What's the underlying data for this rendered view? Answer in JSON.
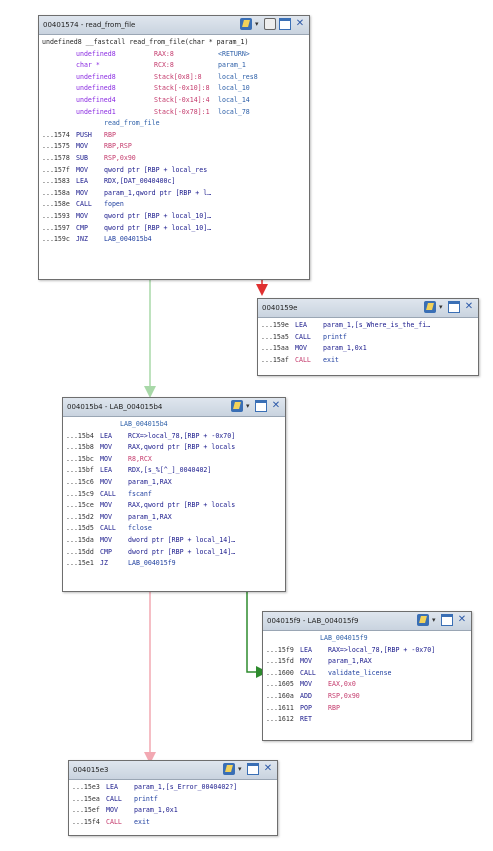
{
  "colors": {
    "edge_true": "#3aa63a",
    "edge_false": "#e03030",
    "edge_uncond": "#a8d8a8",
    "edge_pink": "#f2a8b2"
  },
  "blocks": {
    "read_from_file": {
      "title": "00401574 - read_from_file",
      "signature": "undefined8 __fastcall read_from_file(char * param_1)",
      "vars": [
        {
          "type": "undefined8",
          "loc": "RAX:8",
          "name": "<RETURN>"
        },
        {
          "type": "char *",
          "loc": "RCX:8",
          "name": "param_1"
        },
        {
          "type": "undefined8",
          "loc": "Stack[0x8]:8",
          "name": "local_res8"
        },
        {
          "type": "undefined8",
          "loc": "Stack[-0x10]:8",
          "name": "local_10"
        },
        {
          "type": "undefined4",
          "loc": "Stack[-0x14]:4",
          "name": "local_14"
        },
        {
          "type": "undefined1",
          "loc": "Stack[-0x78]:1",
          "name": "local_78"
        }
      ],
      "label": "read_from_file",
      "lines": [
        {
          "addr": "...1574",
          "mn": "PUSH",
          "ops": "RBP"
        },
        {
          "addr": "...1575",
          "mn": "MOV",
          "ops": "RBP,RSP"
        },
        {
          "addr": "...1578",
          "mn": "SUB",
          "ops": "RSP,0x90"
        },
        {
          "addr": "...157f",
          "mn": "MOV",
          "ops": "qword ptr [RBP + local_res"
        },
        {
          "addr": "...1583",
          "mn": "LEA",
          "ops": "RDX,[DAT_0040400c]"
        },
        {
          "addr": "...158a",
          "mn": "MOV",
          "ops": "param_1,qword ptr [RBP + l…"
        },
        {
          "addr": "...158e",
          "mn": "CALL",
          "ops": "fopen"
        },
        {
          "addr": "...1593",
          "mn": "MOV",
          "ops": "qword ptr [RBP + local_10]…"
        },
        {
          "addr": "...1597",
          "mn": "CMP",
          "ops": "qword ptr [RBP + local_10]…"
        },
        {
          "addr": "...159c",
          "mn": "JNZ",
          "ops": "LAB_004015b4"
        }
      ]
    },
    "blk_159e": {
      "title": "0040159e",
      "lines": [
        {
          "addr": "...159e",
          "mn": "LEA",
          "ops": "param_1,[s_Where_is_the_fi…"
        },
        {
          "addr": "...15a5",
          "mn": "CALL",
          "ops": "printf"
        },
        {
          "addr": "...15aa",
          "mn": "MOV",
          "ops": "param_1,0x1"
        },
        {
          "addr": "...15af",
          "mn": "CALL",
          "ops": "exit"
        }
      ]
    },
    "blk_15b4": {
      "title": "004015b4 - LAB_004015b4",
      "label": "LAB_004015b4",
      "lines": [
        {
          "addr": "...15b4",
          "mn": "LEA",
          "ops": "RCX=>local_78,[RBP + -0x70]"
        },
        {
          "addr": "...15b8",
          "mn": "MOV",
          "ops": "RAX,qword ptr [RBP + locals"
        },
        {
          "addr": "...15bc",
          "mn": "MOV",
          "ops": "R8,RCX"
        },
        {
          "addr": "...15bf",
          "mn": "LEA",
          "ops": "RDX,[s_%[^_]_0040402]"
        },
        {
          "addr": "...15c6",
          "mn": "MOV",
          "ops": "param_1,RAX"
        },
        {
          "addr": "...15c9",
          "mn": "CALL",
          "ops": "fscanf"
        },
        {
          "addr": "...15ce",
          "mn": "MOV",
          "ops": "RAX,qword ptr [RBP + locals"
        },
        {
          "addr": "...15d2",
          "mn": "MOV",
          "ops": "param_1,RAX"
        },
        {
          "addr": "...15d5",
          "mn": "CALL",
          "ops": "fclose"
        },
        {
          "addr": "...15da",
          "mn": "MOV",
          "ops": "dword ptr [RBP + local_14]…"
        },
        {
          "addr": "...15dd",
          "mn": "CMP",
          "ops": "dword ptr [RBP + local_14]…"
        },
        {
          "addr": "...15e1",
          "mn": "JZ",
          "ops": "LAB_004015f9"
        }
      ]
    },
    "blk_15f9": {
      "title": "004015f9 - LAB_004015f9",
      "label": "LAB_004015f9",
      "lines": [
        {
          "addr": "...15f9",
          "mn": "LEA",
          "ops": "RAX=>local_78,[RBP + -0x70]"
        },
        {
          "addr": "...15fd",
          "mn": "MOV",
          "ops": "param_1,RAX"
        },
        {
          "addr": "...1600",
          "mn": "CALL",
          "ops": "validate_license"
        },
        {
          "addr": "...1605",
          "mn": "MOV",
          "ops": "EAX,0x0"
        },
        {
          "addr": "...160a",
          "mn": "ADD",
          "ops": "RSP,0x90"
        },
        {
          "addr": "...1611",
          "mn": "POP",
          "ops": "RBP"
        },
        {
          "addr": "...1612",
          "mn": "RET",
          "ops": ""
        }
      ]
    },
    "blk_15e3": {
      "title": "004015e3",
      "lines": [
        {
          "addr": "...15e3",
          "mn": "LEA",
          "ops": "param_1,[s_Error_0040402?]"
        },
        {
          "addr": "...15ea",
          "mn": "CALL",
          "ops": "printf"
        },
        {
          "addr": "...15ef",
          "mn": "MOV",
          "ops": "param_1,0x1"
        },
        {
          "addr": "...15f4",
          "mn": "CALL",
          "ops": "exit"
        }
      ]
    }
  }
}
